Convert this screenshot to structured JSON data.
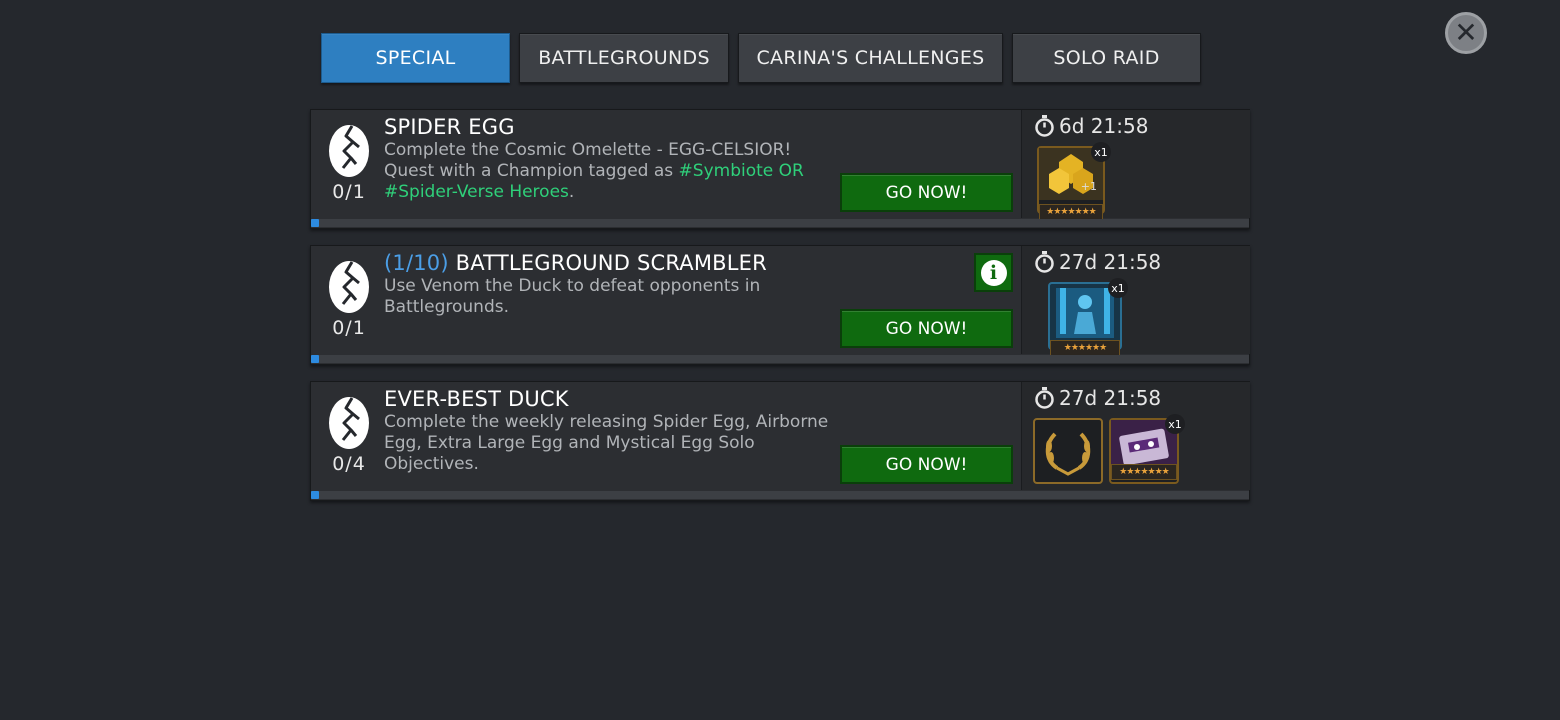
{
  "tabs": [
    {
      "label": "SPECIAL",
      "active": true
    },
    {
      "label": "BATTLEGROUNDS",
      "active": false
    },
    {
      "label": "CARINA'S CHALLENGES",
      "active": false
    },
    {
      "label": "SOLO RAID",
      "active": false
    }
  ],
  "close_icon": "close-x-icon",
  "quests": [
    {
      "counter": "0/1",
      "title_prefix": "",
      "title": "SPIDER EGG",
      "desc_plain": "Complete the Cosmic Omelette - EGG-CELSIOR! Quest with a Champion tagged as ",
      "desc_tag": "#Symbiote OR #Spider-Verse Heroes",
      "desc_end": ".",
      "button": "GO NOW!",
      "timer": "6d 21:58",
      "progress": 0.0,
      "rewards": [
        {
          "icon": "gold-crystal-icon",
          "count": "x1",
          "extra": "+1",
          "stars": "★★★★★★★"
        }
      ]
    },
    {
      "counter": "0/1",
      "title_prefix": "(1/10)",
      "title": "BATTLEGROUND SCRAMBLER",
      "desc_plain": "Use Venom the Duck to defeat opponents in Battlegrounds.",
      "desc_tag": "",
      "desc_end": "",
      "button": "GO NOW!",
      "timer": "27d 21:58",
      "progress": 0.0,
      "has_info": true,
      "rewards": [
        {
          "icon": "champion-crystal-icon",
          "count": "x1",
          "stars": "★★★★★★"
        }
      ]
    },
    {
      "counter": "0/4",
      "title_prefix": "",
      "title": "EVER-BEST DUCK",
      "desc_plain": "Complete the weekly releasing Spider Egg, Airborne Egg, Extra Large Egg and Mystical Egg Solo Objectives.",
      "desc_tag": "",
      "desc_end": "",
      "button": "GO NOW!",
      "timer": "27d 21:58",
      "progress": 0.0,
      "rewards": [
        {
          "icon": "laurel-wreath-icon"
        },
        {
          "icon": "purple-cassette-icon",
          "count": "x1",
          "stars": "★★★★★★★"
        }
      ]
    }
  ],
  "colors": {
    "background": "#25282d",
    "active_tab": "#2e7fc1",
    "go_button": "#0f6a0f",
    "progress": "#2d8be0",
    "tag_green": "#2fd07a",
    "prefix_blue": "#4b9ee6"
  }
}
